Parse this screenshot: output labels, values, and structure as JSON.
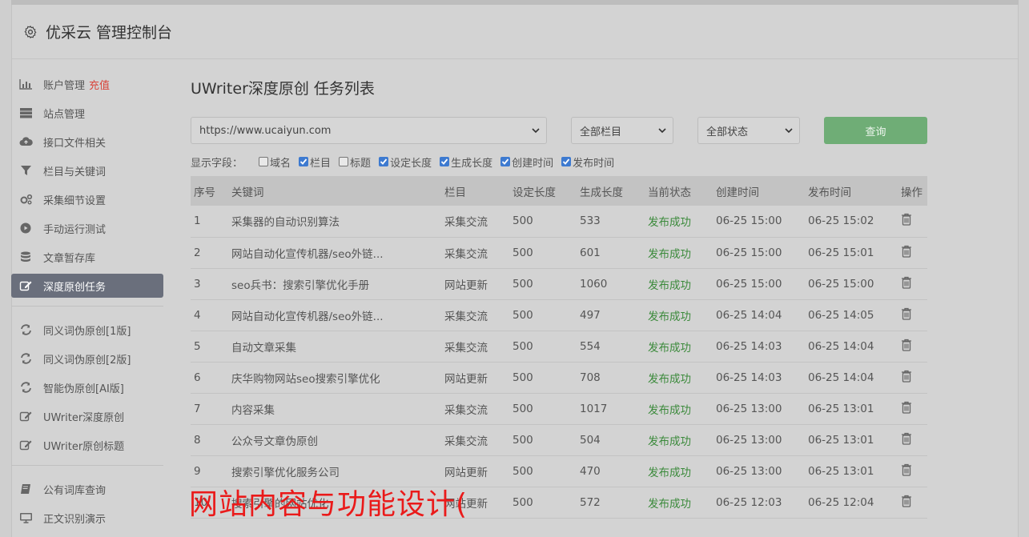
{
  "header": {
    "title": "优采云 管理控制台",
    "icon": "gear-icon"
  },
  "sidebar": {
    "group1": [
      {
        "icon": "bar-chart-icon",
        "label": "账户管理",
        "extra": "充值"
      },
      {
        "icon": "server-icon",
        "label": "站点管理"
      },
      {
        "icon": "cloud-upload-icon",
        "label": "接口文件相关"
      },
      {
        "icon": "filter-icon",
        "label": "栏目与关键词"
      },
      {
        "icon": "cogs-icon",
        "label": "采集细节设置"
      },
      {
        "icon": "play-circle-icon",
        "label": "手动运行测试"
      },
      {
        "icon": "database-icon",
        "label": "文章暂存库"
      },
      {
        "icon": "edit-icon",
        "label": "深度原创任务",
        "active": true
      }
    ],
    "group2": [
      {
        "icon": "refresh-icon",
        "label": "同义词伪原创[1版]"
      },
      {
        "icon": "refresh-icon",
        "label": "同义词伪原创[2版]"
      },
      {
        "icon": "refresh-icon",
        "label": "智能伪原创[AI版]"
      },
      {
        "icon": "edit-icon",
        "label": "UWriter深度原创"
      },
      {
        "icon": "edit-icon",
        "label": "UWriter原创标题"
      }
    ],
    "group3": [
      {
        "icon": "book-icon",
        "label": "公有词库查询"
      },
      {
        "icon": "monitor-icon",
        "label": "正文识别演示"
      }
    ]
  },
  "main": {
    "title": "UWriter深度原创 任务列表",
    "site_select": "https://www.ucaiyun.com",
    "column_select": "全部栏目",
    "status_select": "全部状态",
    "query_button": "查询",
    "fields_label": "显示字段：",
    "fields": [
      {
        "label": "域名",
        "checked": false
      },
      {
        "label": "栏目",
        "checked": true
      },
      {
        "label": "标题",
        "checked": false
      },
      {
        "label": "设定长度",
        "checked": true
      },
      {
        "label": "生成长度",
        "checked": true
      },
      {
        "label": "创建时间",
        "checked": true
      },
      {
        "label": "发布时间",
        "checked": true
      }
    ]
  },
  "table": {
    "headers": [
      "序号",
      "关键词",
      "栏目",
      "设定长度",
      "生成长度",
      "当前状态",
      "创建时间",
      "发布时间",
      "操作"
    ],
    "rows": [
      [
        "1",
        "采集器的自动识别算法",
        "采集交流",
        "500",
        "533",
        "发布成功",
        "06-25 15:00",
        "06-25 15:02"
      ],
      [
        "2",
        "网站自动化宣传机器/seo外链...",
        "采集交流",
        "500",
        "601",
        "发布成功",
        "06-25 15:00",
        "06-25 15:01"
      ],
      [
        "3",
        "seo兵书：搜索引擎优化手册",
        "网站更新",
        "500",
        "1060",
        "发布成功",
        "06-25 15:00",
        "06-25 15:00"
      ],
      [
        "4",
        "网站自动化宣传机器/seo外链...",
        "采集交流",
        "500",
        "497",
        "发布成功",
        "06-25 14:04",
        "06-25 14:05"
      ],
      [
        "5",
        "自动文章采集",
        "采集交流",
        "500",
        "554",
        "发布成功",
        "06-25 14:03",
        "06-25 14:04"
      ],
      [
        "6",
        "庆华购物网站seo搜索引擎优化",
        "网站更新",
        "500",
        "708",
        "发布成功",
        "06-25 14:03",
        "06-25 14:04"
      ],
      [
        "7",
        "内容采集",
        "采集交流",
        "500",
        "1017",
        "发布成功",
        "06-25 13:00",
        "06-25 13:01"
      ],
      [
        "8",
        "公众号文章伪原创",
        "采集交流",
        "500",
        "504",
        "发布成功",
        "06-25 13:00",
        "06-25 13:01"
      ],
      [
        "9",
        "搜索引擎优化服务公司",
        "网站更新",
        "500",
        "470",
        "发布成功",
        "06-25 13:00",
        "06-25 13:01"
      ],
      [
        "10",
        "搜索引擎的网站优化",
        "网站更新",
        "500",
        "572",
        "发布成功",
        "06-25 12:03",
        "06-25 12:04"
      ]
    ]
  },
  "overlay_text": "网站内容与功能设计(",
  "colors": {
    "query_button": "#6fad76",
    "active_nav": "#6a6f7c",
    "success": "#3b8a3b",
    "recharge": "#d9443a",
    "overlay": "#ea1a1a"
  }
}
